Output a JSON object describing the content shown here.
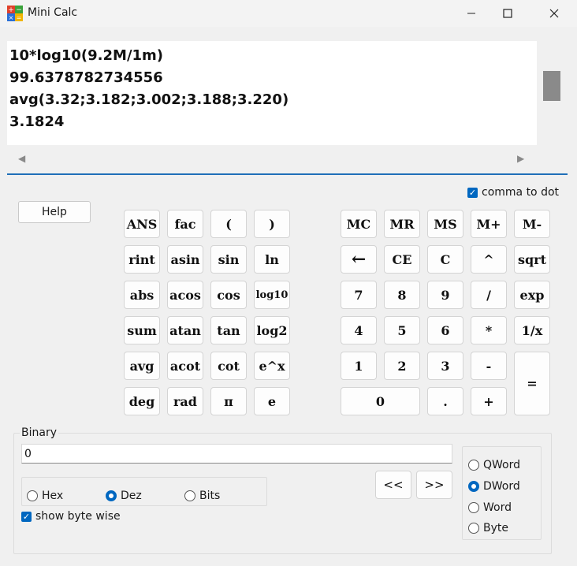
{
  "window": {
    "title": "Mini Calc"
  },
  "display": {
    "lines": [
      "10*log10(9.2M/1m)",
      "99.6378782734556",
      "avg(3.32;3.182;3.002;3.188;3.220)",
      "3.1824"
    ]
  },
  "options": {
    "comma_to_dot_label": "comma to dot",
    "comma_to_dot_checked": true
  },
  "help_label": "Help",
  "func_keys": [
    [
      "ANS",
      "fac",
      "(",
      ")"
    ],
    [
      "rint",
      "asin",
      "sin",
      "ln"
    ],
    [
      "abs",
      "acos",
      "cos",
      "log10"
    ],
    [
      "sum",
      "atan",
      "tan",
      "log2"
    ],
    [
      "avg",
      "acot",
      "cot",
      "e^x"
    ],
    [
      "deg",
      "rad",
      "π",
      "e"
    ]
  ],
  "num_keys": [
    [
      "MC",
      "MR",
      "MS",
      "M+",
      "M-"
    ],
    [
      "←",
      "CE",
      "C",
      "^",
      "sqrt"
    ],
    [
      "7",
      "8",
      "9",
      "/",
      "exp"
    ],
    [
      "4",
      "5",
      "6",
      "*",
      "1/x"
    ],
    [
      "1",
      "2",
      "3",
      "-",
      "="
    ],
    [
      "0",
      ".",
      "+"
    ]
  ],
  "binary": {
    "group_label": "Binary",
    "value": "0",
    "base_options": [
      "Hex",
      "Dez",
      "Bits"
    ],
    "base_selected": "Dez",
    "show_byte_wise_label": "show byte wise",
    "show_byte_wise_checked": true,
    "shift_left_label": "<<",
    "shift_right_label": ">>",
    "size_options": [
      "QWord",
      "DWord",
      "Word",
      "Byte"
    ],
    "size_selected": "DWord"
  }
}
